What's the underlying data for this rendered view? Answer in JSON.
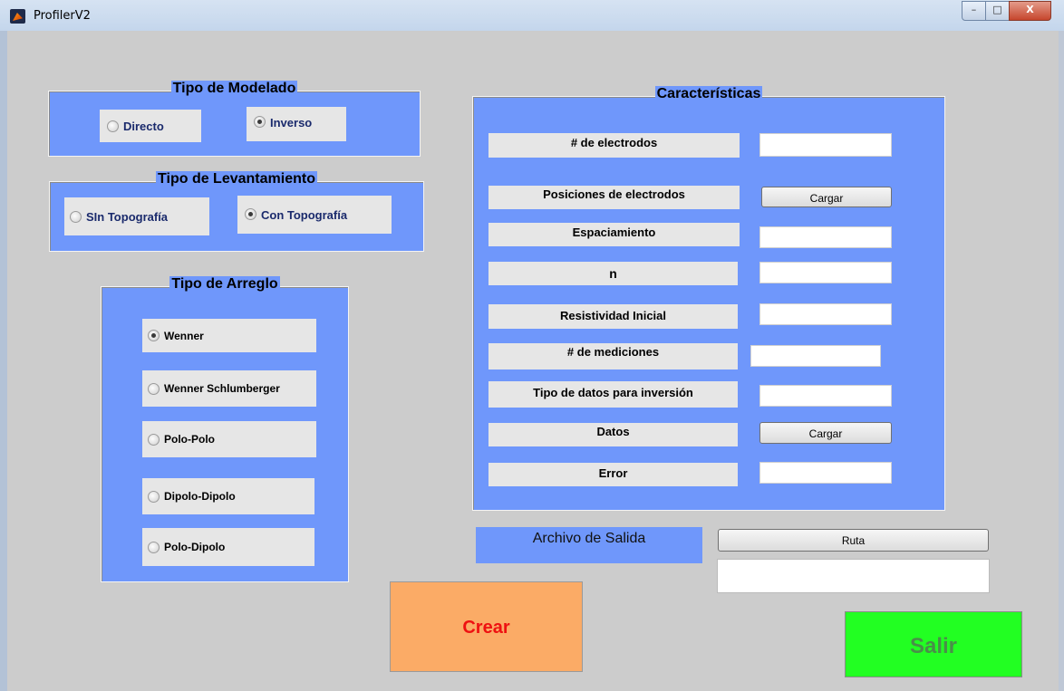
{
  "window": {
    "title": "ProfilerV2",
    "minimize_glyph": "–",
    "maximize_glyph": "□",
    "close_glyph": "X"
  },
  "modelado": {
    "title": "Tipo de Modelado",
    "options": [
      "Directo",
      "Inverso"
    ],
    "selected": "Inverso"
  },
  "levantamiento": {
    "title": "Tipo de Levantamiento",
    "options": [
      "SIn Topografía",
      "Con Topografía"
    ],
    "selected": "Con Topografía"
  },
  "arreglo": {
    "title": "Tipo de Arreglo",
    "options": [
      "Wenner",
      "Wenner Schlumberger",
      "Polo-Polo",
      "Dipolo-Dipolo",
      "Polo-Dipolo"
    ],
    "selected": "Wenner"
  },
  "caracteristicas": {
    "title": "Características",
    "rows": [
      {
        "label": "# de electrodos",
        "value": ""
      },
      {
        "label": "Posiciones de electrodos",
        "button": "Cargar"
      },
      {
        "label": "Espaciamiento",
        "value": ""
      },
      {
        "label": "n",
        "value": ""
      },
      {
        "label": "Resistividad Inicial",
        "value": ""
      },
      {
        "label": "# de mediciones",
        "value": ""
      },
      {
        "label": "Tipo de datos para inversión",
        "value": ""
      },
      {
        "label": "Datos",
        "button": "Cargar"
      },
      {
        "label": "Error",
        "value": ""
      }
    ]
  },
  "salida": {
    "label": "Archivo de Salida",
    "button": "Ruta",
    "value": ""
  },
  "actions": {
    "crear": "Crear",
    "salir": "Salir"
  }
}
